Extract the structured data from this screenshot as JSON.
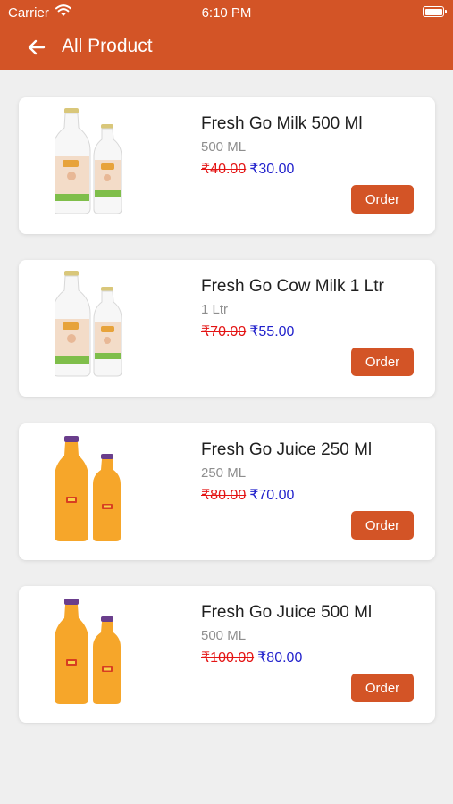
{
  "status_bar": {
    "carrier": "Carrier",
    "time": "6:10 PM"
  },
  "header": {
    "title": "All Product"
  },
  "products": [
    {
      "name": "Fresh Go Milk 500 Ml",
      "quantity": "500 ML",
      "old_price": "₹40.00",
      "price": "₹30.00",
      "button": "Order",
      "image": "milk-bottles"
    },
    {
      "name": "Fresh Go Cow Milk 1 Ltr",
      "quantity": "1 Ltr",
      "old_price": "₹70.00",
      "price": "₹55.00",
      "button": "Order",
      "image": "milk-bottles"
    },
    {
      "name": "Fresh Go Juice 250 Ml",
      "quantity": "250 ML",
      "old_price": "₹80.00",
      "price": "₹70.00",
      "button": "Order",
      "image": "juice-bottles"
    },
    {
      "name": "Fresh Go Juice 500 Ml",
      "quantity": "500 ML",
      "old_price": "₹100.00",
      "price": "₹80.00",
      "button": "Order",
      "image": "juice-bottles"
    }
  ],
  "colors": {
    "brand": "#d35426",
    "old_price": "#e41414",
    "price": "#2222cc",
    "background": "#efefef"
  }
}
